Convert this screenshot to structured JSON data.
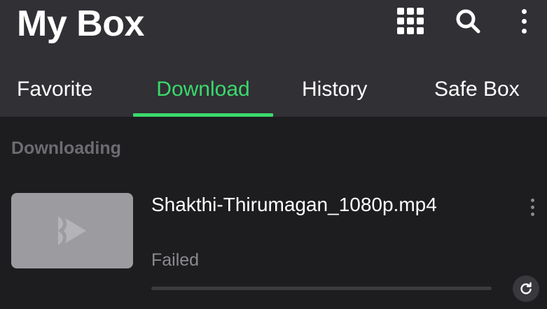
{
  "app": {
    "title": "My Box"
  },
  "header": {
    "icons": {
      "apps": "grid-apps-icon",
      "search": "search-icon",
      "more": "more-vertical-icon"
    }
  },
  "tabs": [
    {
      "label": "Favorite",
      "active": false
    },
    {
      "label": "Download",
      "active": true
    },
    {
      "label": "History",
      "active": false
    },
    {
      "label": "Safe Box",
      "active": false
    }
  ],
  "colors": {
    "accent": "#3bd96b",
    "header_bg": "#303035",
    "page_bg": "#1d1d20",
    "muted_text": "#8a8a8f",
    "thumbnail_bg": "#9b9ba0"
  },
  "downloads": {
    "section_label": "Downloading",
    "items": [
      {
        "file_name": "Shakthi-Thirumagan_1080p.mp4",
        "status": "Failed",
        "progress": 0,
        "icons": {
          "thumbnail": "video-logo-icon",
          "more": "more-vertical-icon",
          "retry": "retry-icon"
        }
      }
    ]
  }
}
